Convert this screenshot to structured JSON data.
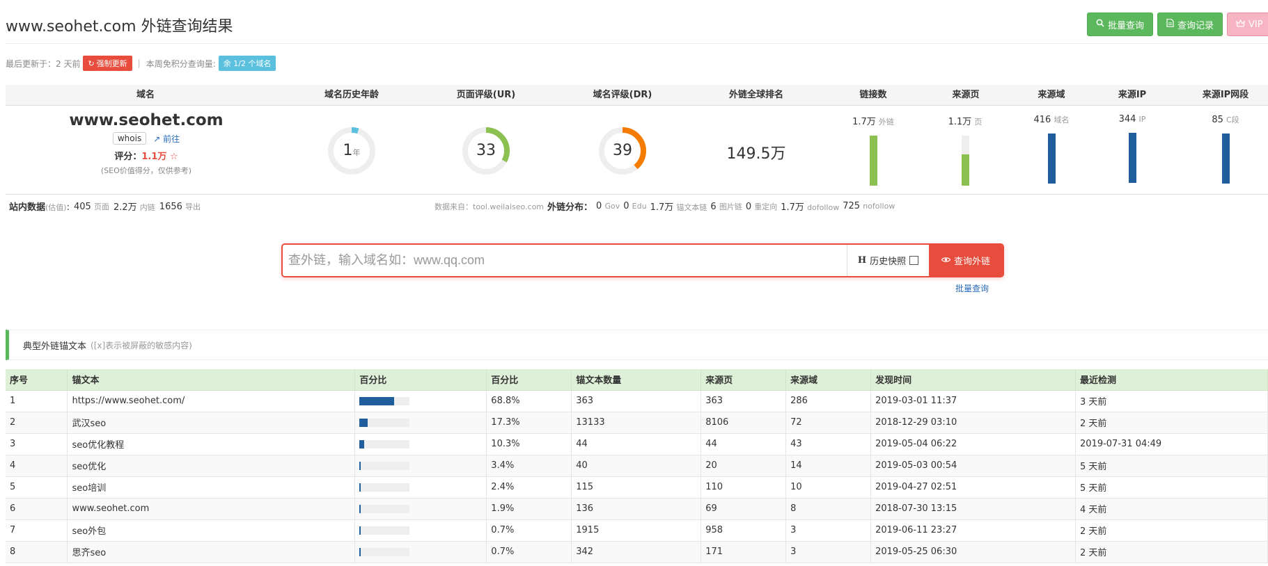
{
  "page": {
    "title": "www.seohet.com 外链查询结果"
  },
  "top_actions": {
    "batch_query": "批量查询",
    "query_history": "查询记录",
    "vip": "VIP"
  },
  "meta": {
    "last_update_label": "最后更新于：2 天前",
    "force_update": "强制更新",
    "weekly_free_label": "本周免积分查询量:",
    "weekly_free_badge": "余 1/2 个域名"
  },
  "stats_headers": {
    "domain": "域名",
    "age": "域名历史年龄",
    "ur": "页面评级(UR)",
    "dr": "域名评级(DR)",
    "rank": "外链全球排名",
    "links": "链接数",
    "ref_pages": "来源页",
    "ref_domains": "来源域",
    "ref_ips": "来源IP",
    "ref_subnets": "来源IP网段"
  },
  "domain": {
    "name": "www.seohet.com",
    "whois": "whois",
    "goto": "前往",
    "score_label": "评分：",
    "score_value": "1.1万",
    "score_note": "(SEO价值得分，仅供参考)"
  },
  "gauges": {
    "age": {
      "value": "1",
      "unit": "年",
      "fraction": 0.05,
      "color": "#5bc0de"
    },
    "ur": {
      "value": "33",
      "fraction": 0.33,
      "color": "#8cc152"
    },
    "dr": {
      "value": "39",
      "fraction": 0.39,
      "color": "#f57c00"
    }
  },
  "rank": "149.5万",
  "bars": {
    "links": {
      "value": "1.7万",
      "unit": "外链",
      "fraction": 1.0,
      "color": "#8cc152"
    },
    "ref_pages": {
      "value": "1.1万",
      "unit": "页",
      "fraction": 0.62,
      "color": "#8cc152"
    },
    "ref_domains": {
      "value": "416",
      "unit": "域名",
      "fraction": 1.0,
      "color": "#1f5d9d"
    },
    "ref_ips": {
      "value": "344",
      "unit": "IP",
      "fraction": 1.0,
      "color": "#1f5d9d"
    },
    "ref_subnets": {
      "value": "85",
      "unit": "C段",
      "fraction": 1.0,
      "color": "#1f5d9d"
    }
  },
  "site_data": {
    "label": "站内数据",
    "label_note": "(估值)",
    "pages_value": "405",
    "pages_unit": "页面",
    "internal_value": "2.2万",
    "internal_unit": "内链",
    "outbound_value": "1656",
    "outbound_unit": "导出"
  },
  "source": {
    "from_label": "数据来自：tool.weilaiseo.com",
    "dist_label": "外链分布：",
    "gov_value": "0",
    "gov_unit": "Gov",
    "edu_value": "0",
    "edu_unit": "Edu",
    "anchor_value": "1.7万",
    "anchor_unit": "锚文本链",
    "image_value": "6",
    "image_unit": "图片链",
    "redirect_value": "0",
    "redirect_unit": "重定向",
    "dofollow_value": "1.7万",
    "dofollow_unit": "dofollow",
    "nofollow_value": "725",
    "nofollow_unit": "nofollow"
  },
  "search": {
    "placeholder": "查外链，输入域名如：www.qq.com",
    "history_h": "H",
    "history_label": "历史快照",
    "submit": "查询外链",
    "batch_link": "批量查询"
  },
  "anchors": {
    "title": "典型外链锚文本",
    "note": "([x]表示被屏蔽的敏感内容)",
    "headers": [
      "序号",
      "锚文本",
      "百分比",
      "百分比",
      "锚文本数量",
      "来源页",
      "来源域",
      "发现时间",
      "最近检测"
    ],
    "rows": [
      {
        "no": "1",
        "text": "https://www.seohet.com/",
        "pct": "68.8%",
        "frac": 0.688,
        "count": "363",
        "pages": "363",
        "domains": "286",
        "found": "2019-03-01 11:37",
        "checked": "3 天前"
      },
      {
        "no": "2",
        "text": "武汉seo",
        "pct": "17.3%",
        "frac": 0.173,
        "count": "13133",
        "pages": "8106",
        "domains": "72",
        "found": "2018-12-29 03:10",
        "checked": "2 天前"
      },
      {
        "no": "3",
        "text": "seo优化教程",
        "pct": "10.3%",
        "frac": 0.103,
        "count": "44",
        "pages": "44",
        "domains": "43",
        "found": "2019-05-04 06:22",
        "checked": "2019-07-31 04:49"
      },
      {
        "no": "4",
        "text": "seo优化",
        "pct": "3.4%",
        "frac": 0.034,
        "count": "40",
        "pages": "20",
        "domains": "14",
        "found": "2019-05-03 00:54",
        "checked": "5 天前"
      },
      {
        "no": "5",
        "text": "seo培训",
        "pct": "2.4%",
        "frac": 0.024,
        "count": "115",
        "pages": "110",
        "domains": "10",
        "found": "2019-04-27 02:51",
        "checked": "5 天前"
      },
      {
        "no": "6",
        "text": "www.seohet.com",
        "pct": "1.9%",
        "frac": 0.019,
        "count": "136",
        "pages": "69",
        "domains": "8",
        "found": "2018-07-30 13:15",
        "checked": "4 天前"
      },
      {
        "no": "7",
        "text": "seo外包",
        "pct": "0.7%",
        "frac": 0.007,
        "count": "1915",
        "pages": "958",
        "domains": "3",
        "found": "2019-06-11 23:27",
        "checked": "2 天前"
      },
      {
        "no": "8",
        "text": "思齐seo",
        "pct": "0.7%",
        "frac": 0.007,
        "count": "342",
        "pages": "171",
        "domains": "3",
        "found": "2019-05-25 06:30",
        "checked": "2 天前"
      }
    ]
  }
}
